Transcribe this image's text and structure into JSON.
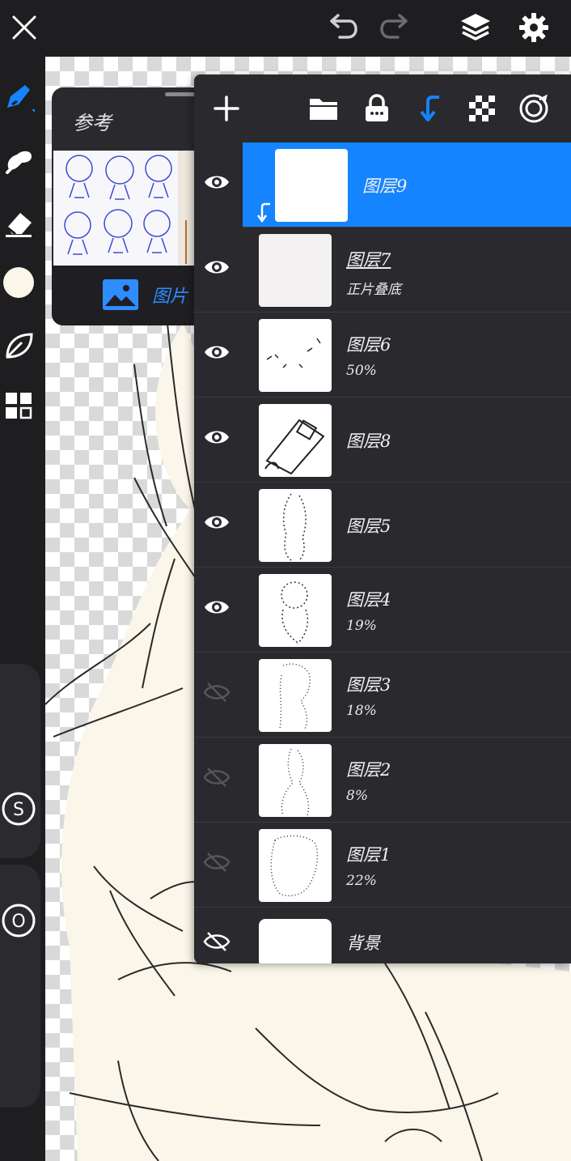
{
  "reference": {
    "title": "参考",
    "image_button_label": "图片"
  },
  "colors": {
    "accent": "#1584ff",
    "panel_bg": "#2a2a2e",
    "app_bg": "#1e1e20",
    "current_color": "#fbf6ea"
  },
  "icons": {
    "top": [
      "close-icon",
      "undo-icon",
      "redo-icon",
      "layers-icon",
      "settings-icon"
    ],
    "left": [
      "brush-icon",
      "smudge-icon",
      "eraser-icon",
      "color-swatch",
      "leaf-icon",
      "grid-icon",
      "s-icon",
      "o-icon"
    ],
    "layers_header": [
      "add-layer-icon",
      "folder-icon",
      "lock-icon",
      "clip-down-icon",
      "transparency-icon",
      "target-icon"
    ]
  },
  "layers": [
    {
      "name": "图层9",
      "sub": "",
      "visible": true,
      "selected": true,
      "clipped": true
    },
    {
      "name": "图层7",
      "sub": "正片叠底",
      "visible": true,
      "selected": false,
      "underline": true
    },
    {
      "name": "图层6",
      "sub": "50%",
      "visible": true,
      "selected": false
    },
    {
      "name": "图层8",
      "sub": "",
      "visible": true,
      "selected": false
    },
    {
      "name": "图层5",
      "sub": "",
      "visible": true,
      "selected": false
    },
    {
      "name": "图层4",
      "sub": "19%",
      "visible": true,
      "selected": false
    },
    {
      "name": "图层3",
      "sub": "18%",
      "visible": false,
      "selected": false
    },
    {
      "name": "图层2",
      "sub": "8%",
      "visible": false,
      "selected": false
    },
    {
      "name": "图层1",
      "sub": "22%",
      "visible": false,
      "selected": false
    },
    {
      "name": "背景",
      "sub": "",
      "visible": false,
      "selected": false,
      "background": true
    }
  ]
}
